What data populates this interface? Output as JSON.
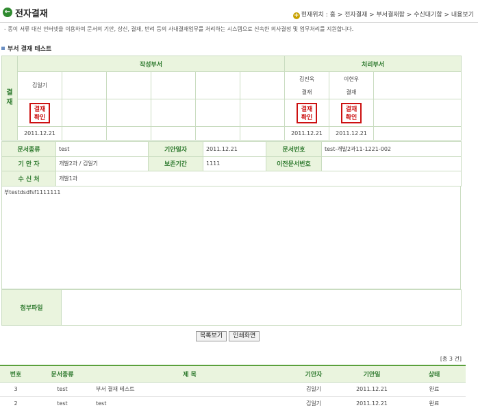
{
  "header": {
    "title": "전자결재",
    "breadcrumb_prefix": "현재위치 : ",
    "breadcrumb": [
      "홈",
      "전자결재",
      "부서결재함",
      "수신대기함",
      "내용보기"
    ],
    "breadcrumb_sep": " > ",
    "description": "- 종이 서류 대신 인터넷을 이용하여 문서의 기안, 상신, 결재, 반려 등의 사내결재업무를 처리하는 시스템으로 신속한 의사결정 및 업무처리를 지원합니다."
  },
  "section": {
    "title": "부서 결재 테스트"
  },
  "approval": {
    "side_label": "결재",
    "group_writing": "작성부서",
    "group_processing": "처리부서",
    "writers": [
      {
        "name": "김일기",
        "role": "",
        "stamp": true,
        "date": "2011.12.21"
      },
      {
        "name": "",
        "role": "",
        "stamp": false,
        "date": ""
      },
      {
        "name": "",
        "role": "",
        "stamp": false,
        "date": ""
      },
      {
        "name": "",
        "role": "",
        "stamp": false,
        "date": ""
      },
      {
        "name": "",
        "role": "",
        "stamp": false,
        "date": ""
      },
      {
        "name": "",
        "role": "",
        "stamp": false,
        "date": ""
      }
    ],
    "processors": [
      {
        "name": "김진욱",
        "role": "결재",
        "stamp": true,
        "date": "2011.12.21"
      },
      {
        "name": "이현우",
        "role": "결재",
        "stamp": true,
        "date": "2011.12.21"
      },
      {
        "name": "",
        "role": "",
        "stamp": false,
        "date": ""
      }
    ],
    "stamp_text": [
      "결재",
      "확인"
    ]
  },
  "info": {
    "doc_type_label": "문서종류",
    "doc_type": "test",
    "draft_date_label": "기안일자",
    "draft_date": "2011.12.21",
    "doc_no_label": "문서번호",
    "doc_no": "test-개발2과11-1221-002",
    "drafter_label": "기 안 자",
    "drafter": "개발2과 / 김일기",
    "retention_label": "보존기간",
    "retention": "1111",
    "prev_doc_label": "이전문서번호",
    "prev_doc": "",
    "recipient_label": "수 신 처",
    "recipient": "개발1과"
  },
  "body_text": "부testdsdfsf1111111",
  "attachment": {
    "label": "첨부파일",
    "value": ""
  },
  "buttons": {
    "list": "목록보기",
    "print": "인쇄화면"
  },
  "list": {
    "total": "[총 3 건]",
    "headers": [
      "번호",
      "문서종류",
      "제  목",
      "기안자",
      "기안일",
      "상태"
    ],
    "rows": [
      {
        "no": "3",
        "type": "test",
        "title": "부서 결재 테스트",
        "drafter": "김일기",
        "date": "2011.12.21",
        "status": "완료"
      },
      {
        "no": "2",
        "type": "test",
        "title": "test",
        "drafter": "김일기",
        "date": "2011.12.21",
        "status": "완료"
      }
    ]
  }
}
